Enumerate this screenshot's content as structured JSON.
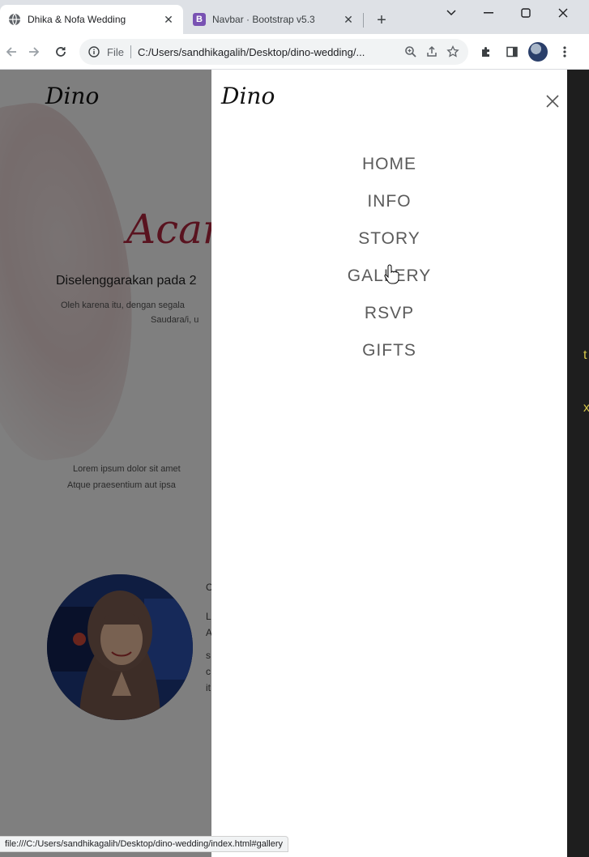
{
  "browser": {
    "tabs": [
      {
        "title": "Dhika & Nofa Wedding",
        "active": true,
        "favicon": "globe-icon"
      },
      {
        "title": "Navbar · Bootstrap v5.3",
        "active": false,
        "favicon": "bootstrap-icon",
        "favicon_letter": "B"
      }
    ],
    "address": {
      "scheme": "File",
      "url": "C:/Users/sandhikagalih/Desktop/dino-wedding/..."
    },
    "status_url": "file:///C:/Users/sandhikagalih/Desktop/dino-wedding/index.html#gallery"
  },
  "page": {
    "brand": "Dino",
    "heading_fragment": "Acar",
    "date_line": "Diselenggarakan pada 2",
    "intro_line_1": "Oleh karena itu, dengan segala",
    "intro_line_2": "Saudara/i, u",
    "lorem_line_1": "Lorem ipsum dolor sit amet",
    "lorem_line_2": "Atque praesentium aut ipsa"
  },
  "offcanvas": {
    "brand": "Dino",
    "menu": [
      "HOME",
      "INFO",
      "STORY",
      "GALLERY",
      "RSVP",
      "GIFTS"
    ]
  },
  "colors": {
    "accent": "#b3263e",
    "menu_text": "#5b5b5b",
    "bootstrap_purple": "#7952b3"
  }
}
